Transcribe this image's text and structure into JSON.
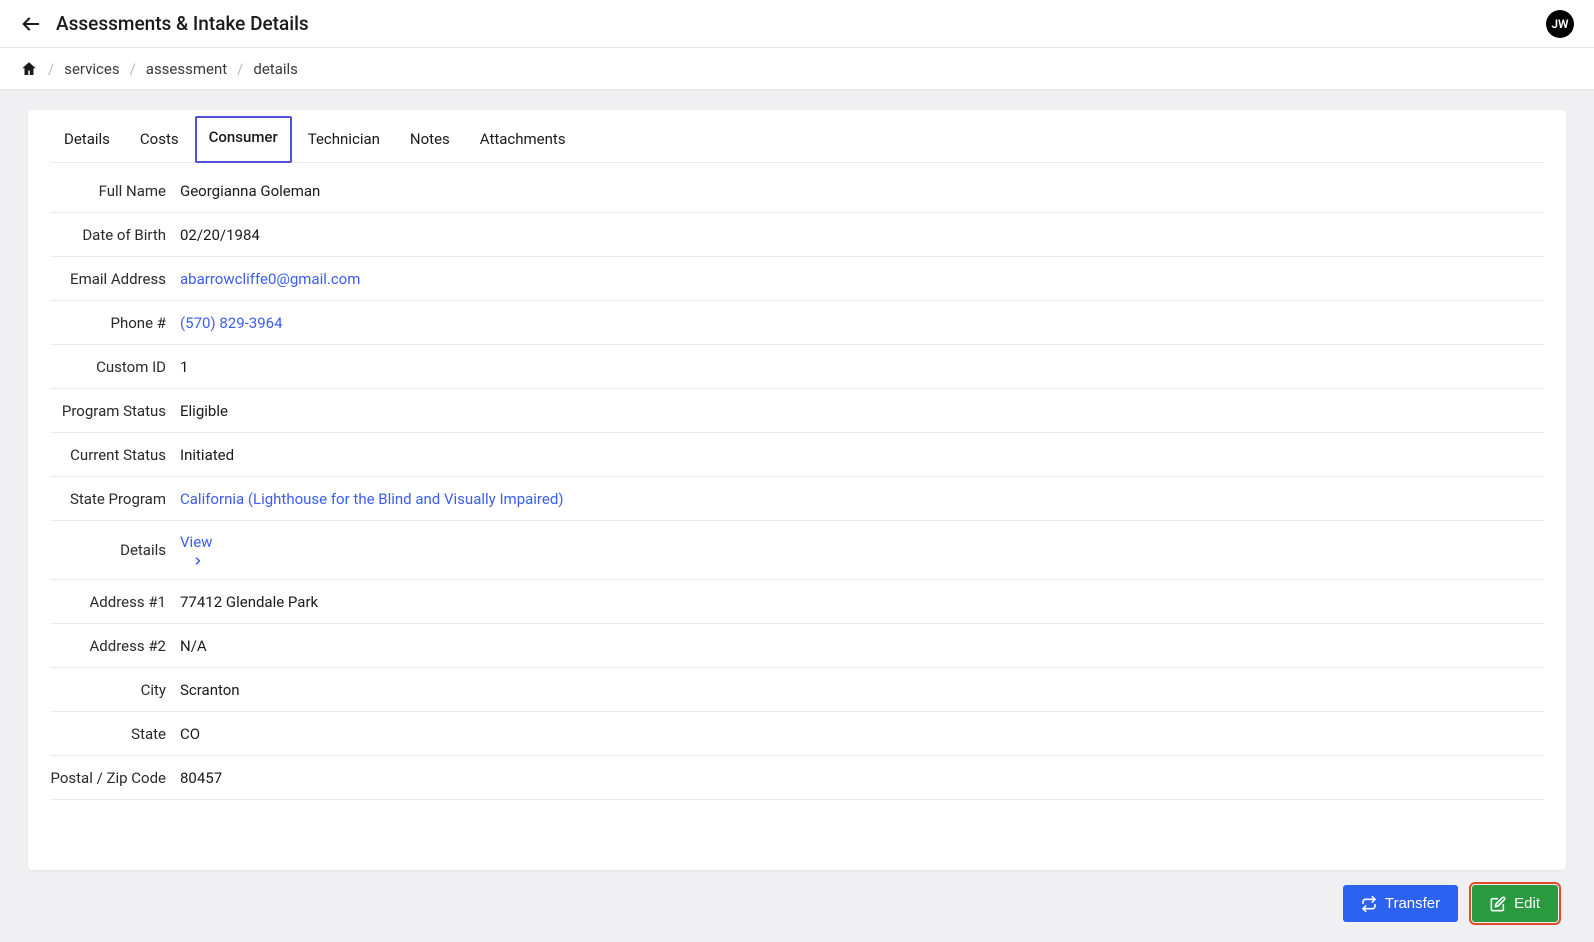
{
  "header": {
    "title": "Assessments & Intake Details",
    "avatar_initials": "JW"
  },
  "breadcrumb": {
    "items": [
      "services",
      "assessment",
      "details"
    ]
  },
  "tabs": [
    {
      "label": "Details"
    },
    {
      "label": "Costs"
    },
    {
      "label": "Consumer",
      "active": true
    },
    {
      "label": "Technician"
    },
    {
      "label": "Notes"
    },
    {
      "label": "Attachments"
    }
  ],
  "consumer": {
    "full_name_label": "Full Name",
    "full_name": "Georgianna Goleman",
    "dob_label": "Date of Birth",
    "dob": "02/20/1984",
    "email_label": "Email Address",
    "email": "abarrowcliffe0@gmail.com",
    "phone_label": "Phone #",
    "phone": "(570) 829-3964",
    "custom_id_label": "Custom ID",
    "custom_id": "1",
    "program_status_label": "Program Status",
    "program_status": "Eligible",
    "current_status_label": "Current Status",
    "current_status": "Initiated",
    "state_program_label": "State Program",
    "state_program": "California (Lighthouse for the Blind and Visually Impaired)",
    "details_label": "Details",
    "details_link": "View",
    "address1_label": "Address #1",
    "address1": "77412 Glendale Park",
    "address2_label": "Address #2",
    "address2": "N/A",
    "city_label": "City",
    "city": "Scranton",
    "state_label": "State",
    "state": "CO",
    "zip_label": "Postal / Zip Code",
    "zip": "80457"
  },
  "actions": {
    "transfer": "Transfer",
    "edit": "Edit"
  }
}
